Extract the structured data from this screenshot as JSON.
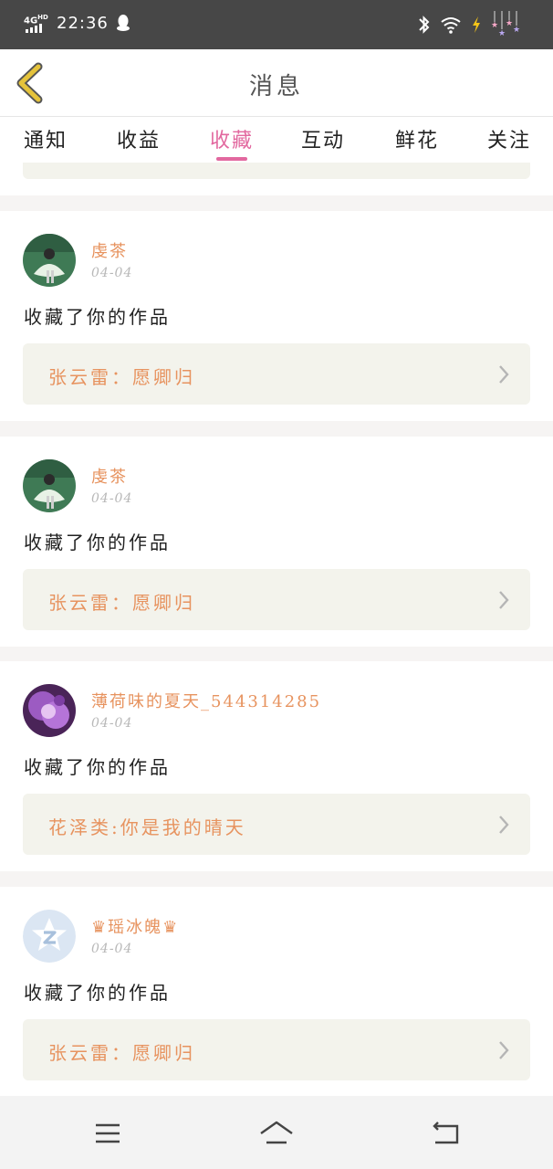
{
  "status_bar": {
    "network": "4G",
    "network_sup": "HD",
    "time": "22:36",
    "icons": [
      "signal-icon",
      "qq-icon",
      "bluetooth-icon",
      "wifi-icon",
      "charging-icon",
      "decoration-icon"
    ]
  },
  "header": {
    "title": "消息",
    "back_icon": "chevron-left-icon"
  },
  "tabs": [
    {
      "label": "通知",
      "active": false
    },
    {
      "label": "收益",
      "active": false
    },
    {
      "label": "收藏",
      "active": true
    },
    {
      "label": "互动",
      "active": false
    },
    {
      "label": "鲜花",
      "active": false
    },
    {
      "label": "关注",
      "active": false
    }
  ],
  "messages": [
    {
      "username": "虔茶",
      "date": "04-04",
      "action": "收藏了你的作品",
      "work": "张云雷：愿卿归",
      "avatar": "green-photo"
    },
    {
      "username": "虔茶",
      "date": "04-04",
      "action": "收藏了你的作品",
      "work": "张云雷：愿卿归",
      "avatar": "green-photo"
    },
    {
      "username": "薄荷味的夏天_544314285",
      "date": "04-04",
      "action": "收藏了你的作品",
      "work": "花泽类:你是我的晴天",
      "avatar": "purple-photo"
    },
    {
      "username": "♛瑶冰魄♛",
      "date": "04-04",
      "action": "收藏了你的作品",
      "work": "张云雷：愿卿归",
      "avatar": "default-qq-avatar"
    }
  ],
  "nav_bar": {
    "icons": [
      "menu-icon",
      "home-icon",
      "back-icon"
    ]
  },
  "colors": {
    "accent_pink": "#e2689f",
    "orange_text": "#e7935f",
    "status_bar_bg": "#474747",
    "card_box_bg": "#f3f3ec",
    "back_arrow": "#e5c33b"
  }
}
